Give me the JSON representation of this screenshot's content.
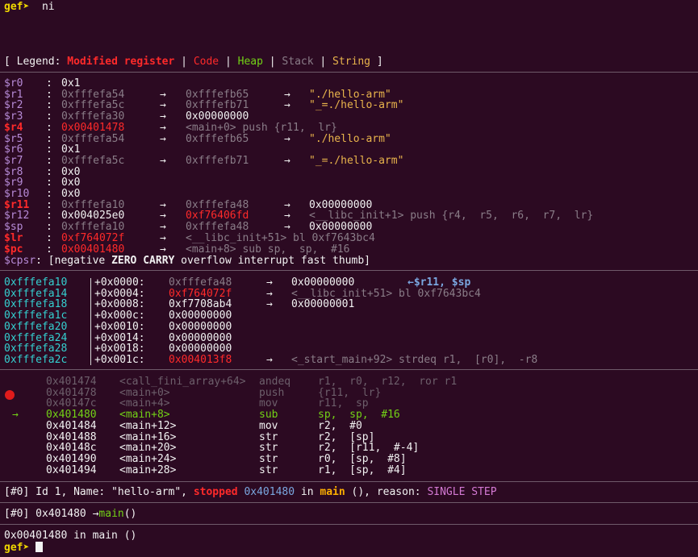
{
  "top": {
    "prompt": "gef➤",
    "command": "ni"
  },
  "legend": {
    "open": "[ Legend: ",
    "modified": "Modified register",
    "sep1": " | ",
    "code": "Code",
    "sep2": " | ",
    "heap": "Heap",
    "sep3": " | ",
    "stack": "Stack",
    "sep4": " | ",
    "string": "String",
    "close": " ]"
  },
  "registers": [
    {
      "name": "$r0 ",
      "value": "0x1"
    },
    {
      "name": "$r1 ",
      "value": "0xfffefa54",
      "arrow1": "→",
      "ptr": "0xfffefb65",
      "arrow2": "→",
      "str": "\"./hello-arm\""
    },
    {
      "name": "$r2 ",
      "value": "0xfffefa5c",
      "arrow1": "→",
      "ptr": "0xfffefb71",
      "arrow2": "→",
      "str": "\"_=./hello-arm\""
    },
    {
      "name": "$r3 ",
      "value": "0xfffefa30",
      "arrow1": "→",
      "ptr": "0x00000000"
    },
    {
      "name": "$r4 ",
      "value": "0x00401478",
      "arrow1": "→",
      "ptr": "<main+0> push {r11,  lr}"
    },
    {
      "name": "$r5 ",
      "value": "0xfffefa54",
      "arrow1": "→",
      "ptr": "0xfffefb65",
      "arrow2": "→",
      "str": "\"./hello-arm\""
    },
    {
      "name": "$r6 ",
      "value": "0x1"
    },
    {
      "name": "$r7 ",
      "value": "0xfffefa5c",
      "arrow1": "→",
      "ptr": "0xfffefb71",
      "arrow2": "→",
      "str": "\"_=./hello-arm\""
    },
    {
      "name": "$r8 ",
      "value": "0x0"
    },
    {
      "name": "$r9 ",
      "value": "0x0"
    },
    {
      "name": "$r10",
      "value": "0x0"
    },
    {
      "name": "$r11",
      "value": "0xfffefa10",
      "arrow1": "→",
      "ptr": "0xfffefa48",
      "arrow2": "→",
      "str": "0x00000000"
    },
    {
      "name": "$r12",
      "value": "0x004025e0",
      "arrow1": "→",
      "ptr": "0xf76406fd",
      "arrow2": "→",
      "str": "<__libc_init+1> push {r4,  r5,  r6,  r7,  lr}"
    },
    {
      "name": "$sp ",
      "value": "0xfffefa10",
      "arrow1": "→",
      "ptr": "0xfffefa48",
      "arrow2": "→",
      "str": "0x00000000"
    },
    {
      "name": "$lr ",
      "value": "0xf764072f",
      "arrow1": "→",
      "ptr": "<__libc_init+51> bl 0xf7643bc4"
    },
    {
      "name": "$pc ",
      "value": "0x00401480",
      "arrow1": "→",
      "ptr": "<main+8> sub sp,  sp,  #16"
    }
  ],
  "cpsr": {
    "name": "$cpsr",
    "open": "[negative ",
    "zero": "ZERO",
    "space": " ",
    "carry": "CARRY",
    "rest": " overflow interrupt fast thumb]"
  },
  "stack": [
    {
      "addr": "0xfffefa10",
      "off": "+0x0000:",
      "val": "0xfffefa48",
      "arrow": "→",
      "deref": "0x00000000",
      "note": "←$r11, $sp"
    },
    {
      "addr": "0xfffefa14",
      "off": "+0x0004:",
      "val": "0xf764072f",
      "arrow": "→",
      "deref": "<__libc_init+51> bl 0xf7643bc4"
    },
    {
      "addr": "0xfffefa18",
      "off": "+0x0008:",
      "val": "0xf7708ab4",
      "arrow": "→",
      "deref": "0x00000001"
    },
    {
      "addr": "0xfffefa1c",
      "off": "+0x000c:",
      "val": "0x00000000"
    },
    {
      "addr": "0xfffefa20",
      "off": "+0x0010:",
      "val": "0x00000000"
    },
    {
      "addr": "0xfffefa24",
      "off": "+0x0014:",
      "val": "0x00000000"
    },
    {
      "addr": "0xfffefa28",
      "off": "+0x0018:",
      "val": "0x00000000"
    },
    {
      "addr": "0xfffefa2c",
      "off": "+0x001c:",
      "val": "0x004013f8",
      "arrow": "→",
      "deref": "<_start_main+92> strdeq r1,  [r0],  -r8"
    }
  ],
  "code": [
    {
      "marker": "",
      "addr": "0x401474",
      "sym": "<call_fini_array+64>",
      "op": "andeq",
      "args": "r1,  r0,  r12,  ror r1"
    },
    {
      "marker": "",
      "addr": "0x401478",
      "sym": "<main+0>",
      "op": "push",
      "args": "{r11,  lr}"
    },
    {
      "marker": "",
      "addr": "0x40147c",
      "sym": "<main+4>",
      "op": "mov",
      "args": "r11,  sp"
    },
    {
      "marker": "→",
      "addr": "0x401480",
      "sym": "<main+8>",
      "op": "sub",
      "args": "sp,  sp,  #16"
    },
    {
      "marker": "",
      "addr": "0x401484",
      "sym": "<main+12>",
      "op": "mov",
      "args": "r2,  #0"
    },
    {
      "marker": "",
      "addr": "0x401488",
      "sym": "<main+16>",
      "op": "str",
      "args": "r2,  [sp]"
    },
    {
      "marker": "",
      "addr": "0x40148c",
      "sym": "<main+20>",
      "op": "str",
      "args": "r2,  [r11,  #-4]"
    },
    {
      "marker": "",
      "addr": "0x401490",
      "sym": "<main+24>",
      "op": "str",
      "args": "r0,  [sp,  #8]"
    },
    {
      "marker": "",
      "addr": "0x401494",
      "sym": "<main+28>",
      "op": "str",
      "args": "r1,  [sp,  #4]"
    }
  ],
  "threads": {
    "idx": "[#0]",
    "pre": " Id 1, Name: \"hello-arm\", ",
    "state": "stopped",
    "sp1": " ",
    "addr": "0x401480",
    "in": " in ",
    "func": "main",
    "rest": " (), reason: ",
    "reason": "SINGLE STEP"
  },
  "trace": {
    "idx": "[#0]",
    "addr": " 0x401480 ",
    "arrow": "→",
    "func": "main",
    "paren": "()"
  },
  "bottom": {
    "location": "0x00401480 in main ()",
    "prompt": "gef➤"
  },
  "colors": {
    "background": "#2c0a22",
    "prompt": "#f0d700",
    "modified": "#ff2a2a",
    "heap": "#73d216",
    "string": "#e9b44c",
    "stack_addr": "#34d0d0"
  }
}
